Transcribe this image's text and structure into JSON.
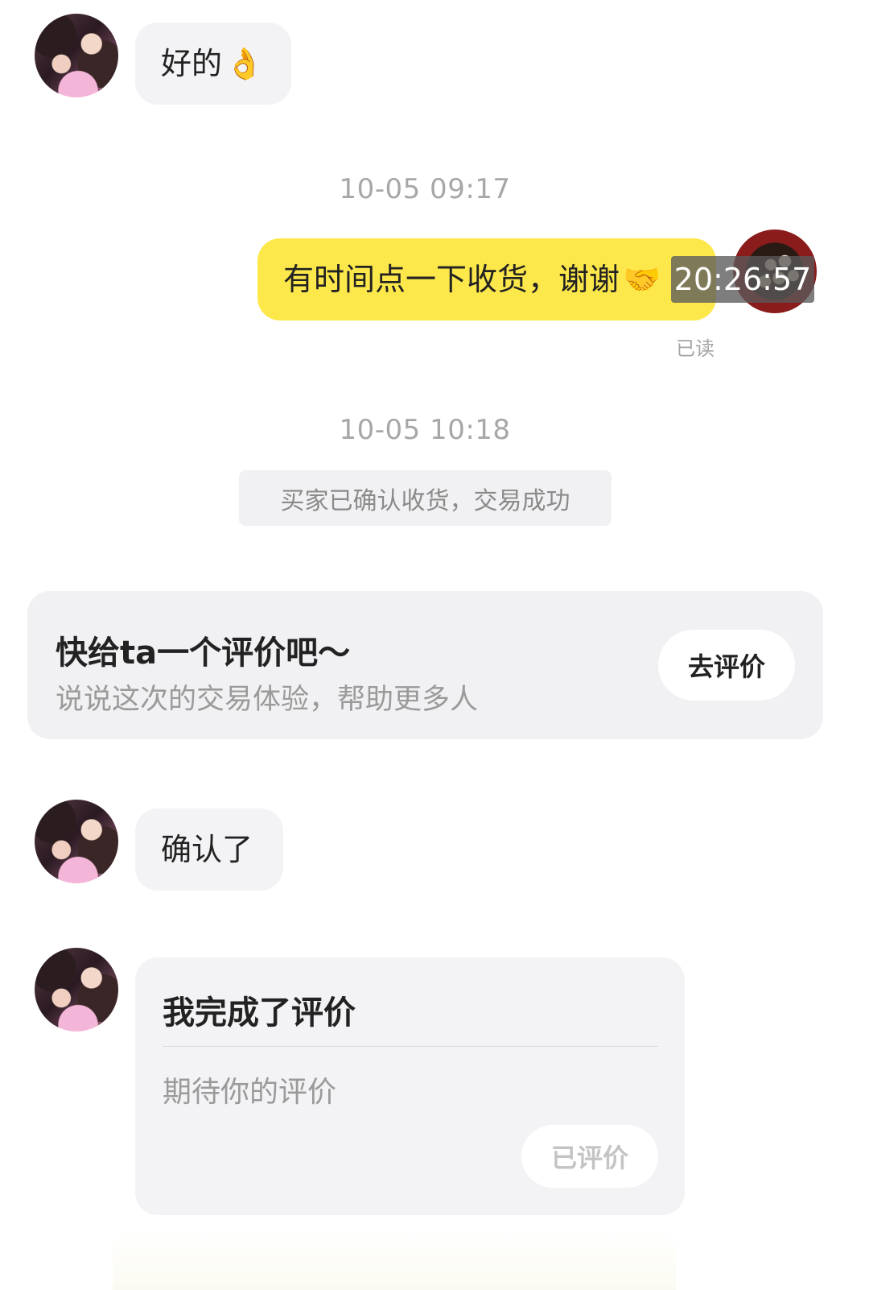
{
  "messages": {
    "m1": {
      "text": "好的",
      "emoji": "👌"
    },
    "t1": "10-05 09:17",
    "m2": {
      "text": "有时间点一下收货，谢谢",
      "emoji": "🤝",
      "read": "已读"
    },
    "overlay_timestamp": "20:26:57",
    "t2": "10-05 10:18",
    "system": "买家已确认收货，交易成功",
    "m3": {
      "text": "确认了"
    }
  },
  "review_prompt": {
    "title": "快给ta一个评价吧～",
    "subtitle": "说说这次的交易体验，帮助更多人",
    "button": "去评价"
  },
  "review_card": {
    "title": "我完成了评价",
    "body": "期待你的评价",
    "button": "已评价"
  },
  "colors": {
    "accent_yellow": "#fde84b",
    "bubble_gray": "#f3f3f5",
    "muted_text": "#a7a7a7"
  }
}
